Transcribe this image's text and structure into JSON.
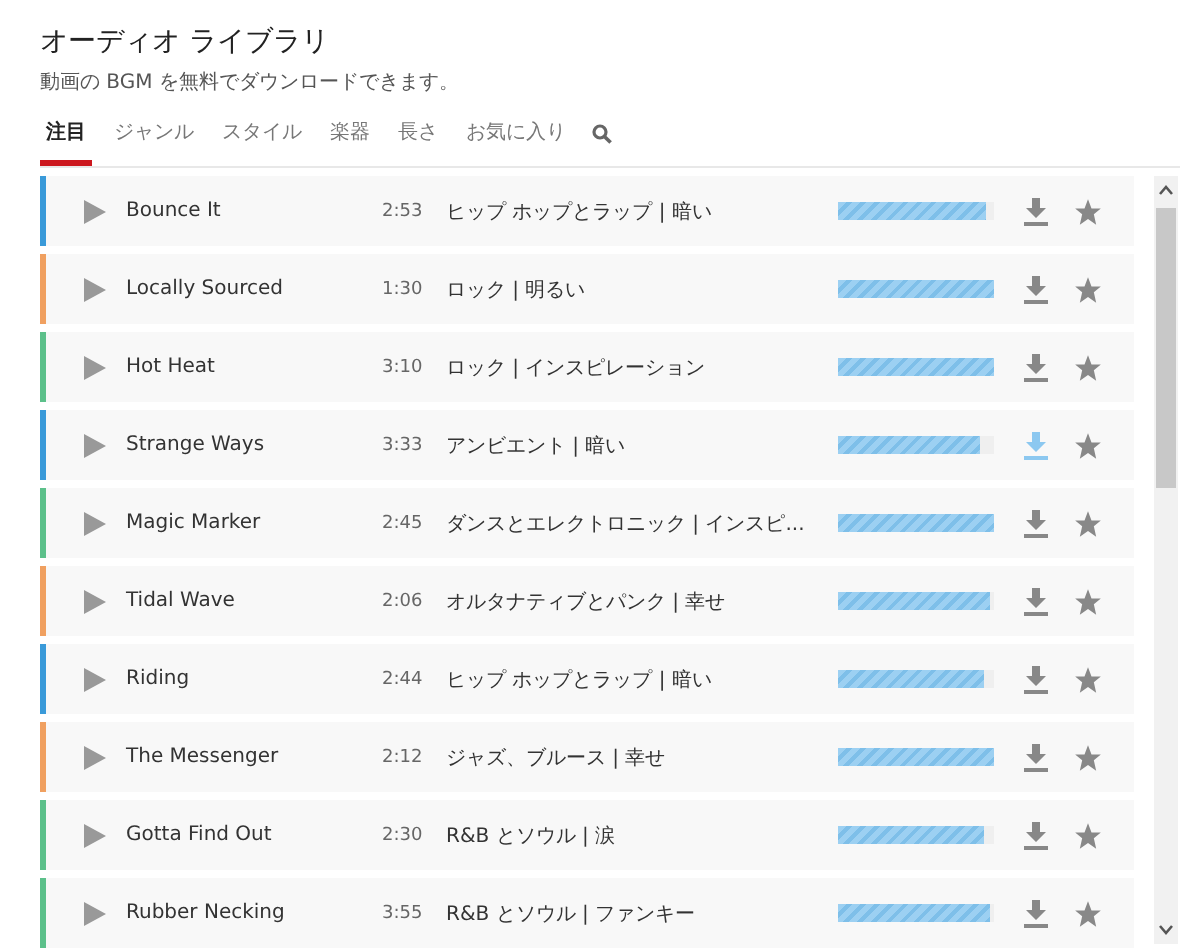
{
  "title": "オーディオ ライブラリ",
  "subtitle": "動画の BGM を無料でダウンロードできます。",
  "tabs": [
    {
      "label": "注目",
      "selected": true
    },
    {
      "label": "ジャンル",
      "selected": false
    },
    {
      "label": "スタイル",
      "selected": false
    },
    {
      "label": "楽器",
      "selected": false
    },
    {
      "label": "長さ",
      "selected": false
    },
    {
      "label": "お気に入り",
      "selected": false
    }
  ],
  "tracks": [
    {
      "title": "Bounce It",
      "duration": "2:53",
      "genre": "ヒップ ホップとラップ | 暗い",
      "color": "#3a9ad9",
      "level": 0.95,
      "download_highlighted": false
    },
    {
      "title": "Locally Sourced",
      "duration": "1:30",
      "genre": "ロック | 明るい",
      "color": "#f0a060",
      "level": 1,
      "download_highlighted": false
    },
    {
      "title": "Hot Heat",
      "duration": "3:10",
      "genre": "ロック | インスピレーション",
      "color": "#5cc08a",
      "level": 1,
      "download_highlighted": false
    },
    {
      "title": "Strange Ways",
      "duration": "3:33",
      "genre": "アンビエント | 暗い",
      "color": "#3a9ad9",
      "level": 0.91,
      "download_highlighted": true
    },
    {
      "title": "Magic Marker",
      "duration": "2:45",
      "genre": "ダンスとエレクトロニック | インスピ...",
      "color": "#5cc08a",
      "level": 1,
      "download_highlighted": false
    },
    {
      "title": "Tidal Wave",
      "duration": "2:06",
      "genre": "オルタナティブとパンク | 幸せ",
      "color": "#f0a060",
      "level": 0.97,
      "download_highlighted": false
    },
    {
      "title": "Riding",
      "duration": "2:44",
      "genre": "ヒップ ホップとラップ | 暗い",
      "color": "#3a9ad9",
      "level": 0.93,
      "download_highlighted": false
    },
    {
      "title": "The Messenger",
      "duration": "2:12",
      "genre": "ジャズ、ブルース | 幸せ",
      "color": "#f0a060",
      "level": 1,
      "download_highlighted": false
    },
    {
      "title": "Gotta Find Out",
      "duration": "2:30",
      "genre": "R&B とソウル | 涙",
      "color": "#5cc08a",
      "level": 0.93,
      "download_highlighted": false
    },
    {
      "title": "Rubber Necking",
      "duration": "3:55",
      "genre": "R&B とソウル | ファンキー",
      "color": "#5cc08a",
      "level": 0.97,
      "download_highlighted": false
    }
  ]
}
